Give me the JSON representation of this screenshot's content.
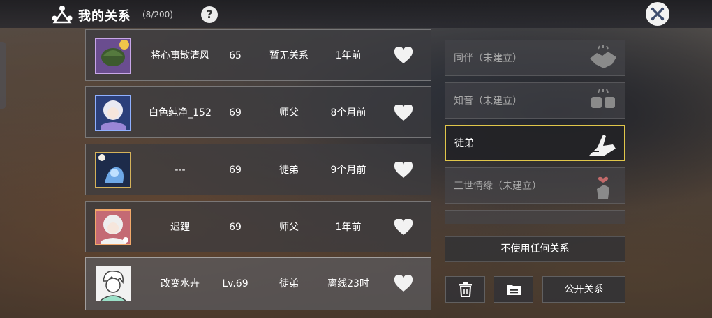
{
  "header": {
    "title": "我的关系",
    "count": "(8/200)",
    "help_label": "?"
  },
  "friends": [
    {
      "name": "将心事散清风",
      "level": "65",
      "relation": "暂无关系",
      "time": "1年前"
    },
    {
      "name": "白色纯净_152",
      "level": "69",
      "relation": "师父",
      "time": "8个月前"
    },
    {
      "name": "---",
      "level": "69",
      "relation": "徒弟",
      "time": "9个月前"
    },
    {
      "name": "迟鲤",
      "level": "69",
      "relation": "师父",
      "time": "1年前"
    },
    {
      "name": "改变水卉",
      "level": "Lv.69",
      "relation": "徒弟",
      "time": "离线23时"
    }
  ],
  "relations": [
    {
      "label": "同伴（未建立）",
      "icon": "handshake-icon"
    },
    {
      "label": "知音（未建立）",
      "icon": "fist-bump-icon"
    },
    {
      "label": "徒弟",
      "icon": "hands-icon",
      "selected": true
    },
    {
      "label": "三世情缘（未建立）",
      "icon": "finger-heart-icon"
    }
  ],
  "actions": {
    "no_relation_label": "不使用任何关系",
    "public_label": "公开关系"
  },
  "colors": {
    "selected_border": "#e0c64a"
  }
}
